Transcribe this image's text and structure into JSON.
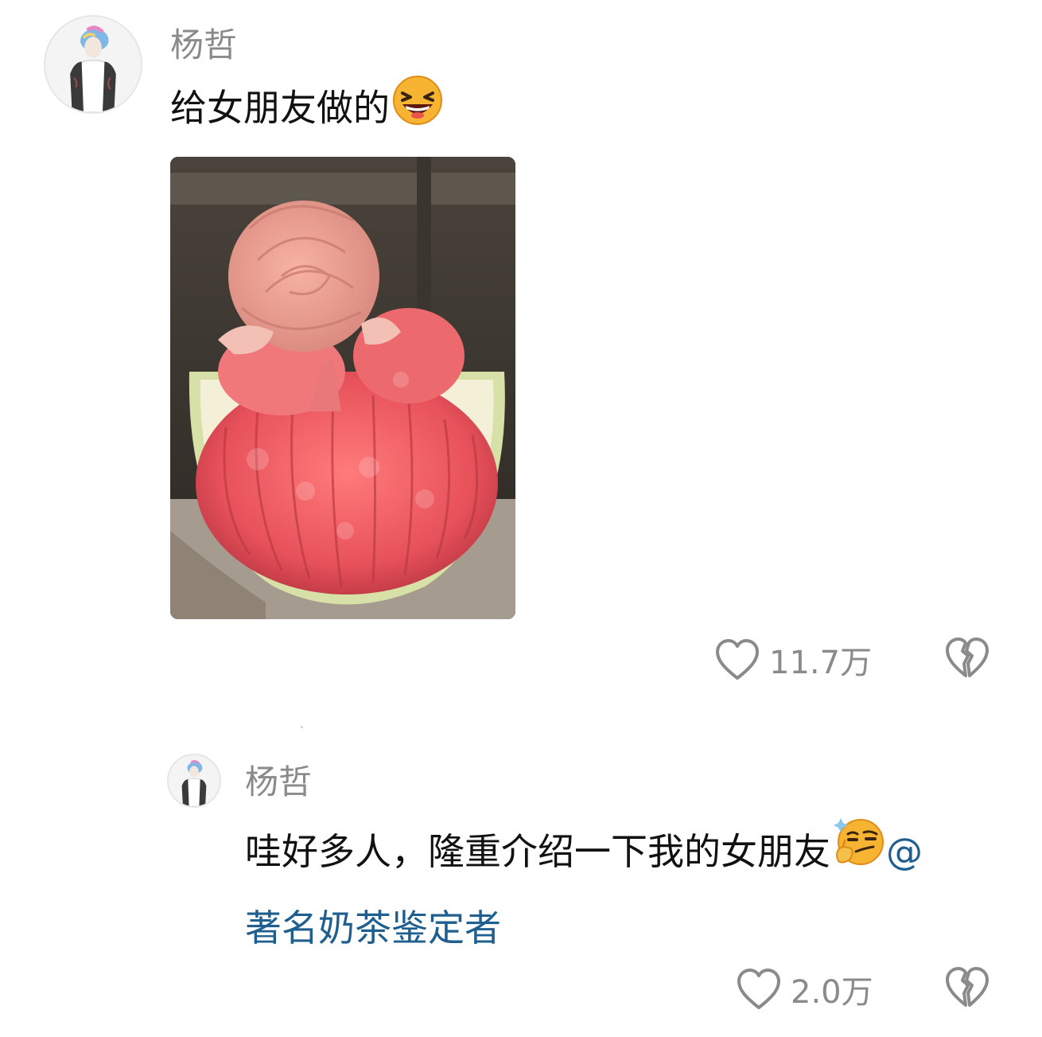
{
  "comment": {
    "username": "杨哲",
    "text": "给女朋友做的",
    "emoji": "grinning-squint-emoji",
    "image": "pomelo-with-peel-rose-photo",
    "likes": "11.7万"
  },
  "reply": {
    "username": "杨哲",
    "text": "哇好多人，隆重介绍一下我的女朋友",
    "emoji": "thinking-smirk-emoji",
    "mention_at": "@",
    "mention_name": "著名奶茶鉴定者",
    "likes": "2.0万"
  },
  "colors": {
    "meta": "#8a8a8a",
    "mention": "#1f5f8f",
    "text": "#111111"
  }
}
